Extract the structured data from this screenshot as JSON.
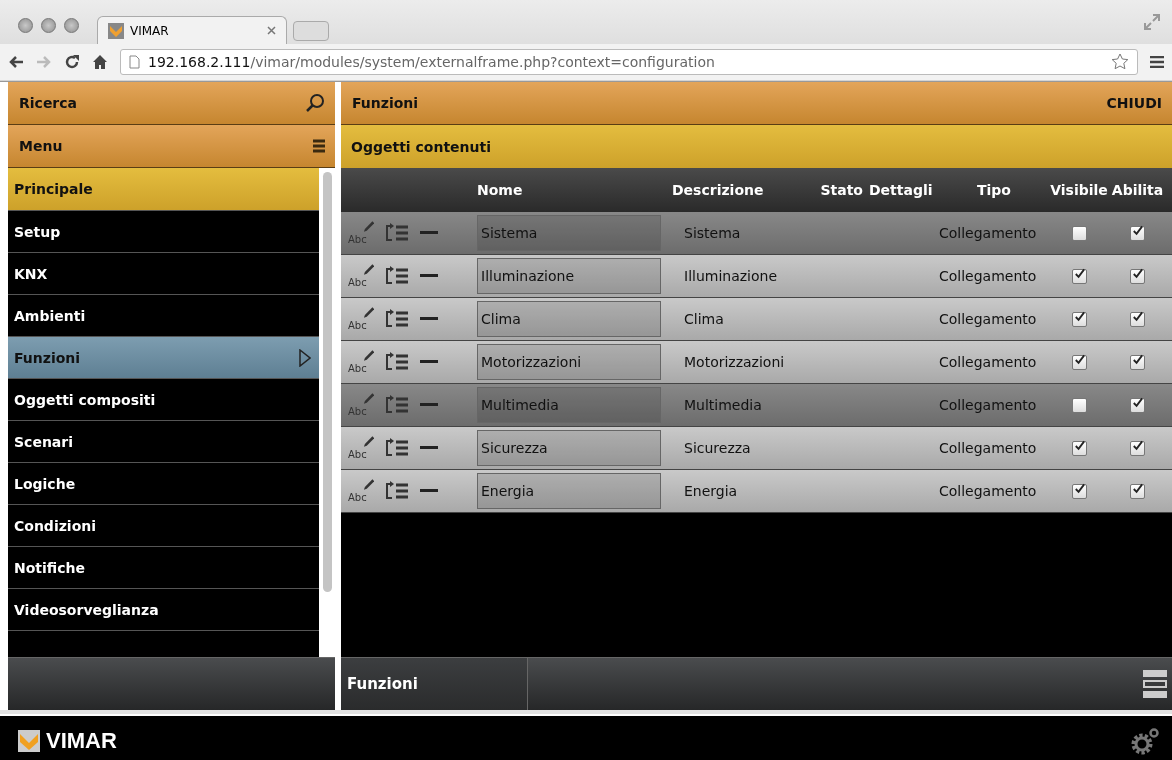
{
  "browser": {
    "tab_title": "VIMAR",
    "url_host": "192.168.2.111",
    "url_path": "/vimar/modules/system/externalframe.php?context=configuration"
  },
  "search_bar": {
    "label": "Ricerca"
  },
  "menu_bar": {
    "label": "Menu"
  },
  "sidebar": {
    "items": [
      {
        "label": "Principale",
        "kind": "header",
        "selected": false
      },
      {
        "label": "Setup",
        "kind": "item",
        "selected": false
      },
      {
        "label": "KNX",
        "kind": "item",
        "selected": false
      },
      {
        "label": "Ambienti",
        "kind": "item",
        "selected": false
      },
      {
        "label": "Funzioni",
        "kind": "item",
        "selected": true
      },
      {
        "label": "Oggetti compositi",
        "kind": "item",
        "selected": false
      },
      {
        "label": "Scenari",
        "kind": "item",
        "selected": false
      },
      {
        "label": "Logiche",
        "kind": "item",
        "selected": false
      },
      {
        "label": "Condizioni",
        "kind": "item",
        "selected": false
      },
      {
        "label": "Notifiche",
        "kind": "item",
        "selected": false
      },
      {
        "label": "Videosorveglianza",
        "kind": "item",
        "selected": false
      }
    ]
  },
  "panel": {
    "title": "Funzioni",
    "close": "CHIUDI",
    "subtitle": "Oggetti contenuti"
  },
  "table": {
    "columns": [
      "Nome",
      "Descrizione",
      "Stato",
      "Dettagli",
      "Tipo",
      "Visibile",
      "Abilita"
    ],
    "rows": [
      {
        "edit_label": "Abc",
        "name": "Sistema",
        "description": "Sistema",
        "type": "Collegamento",
        "visible": false,
        "enabled": true
      },
      {
        "edit_label": "Abc",
        "name": "Illuminazione",
        "description": "Illuminazione",
        "type": "Collegamento",
        "visible": true,
        "enabled": true
      },
      {
        "edit_label": "Abc",
        "name": "Clima",
        "description": "Clima",
        "type": "Collegamento",
        "visible": true,
        "enabled": true
      },
      {
        "edit_label": "Abc",
        "name": "Motorizzazioni",
        "description": "Motorizzazioni",
        "type": "Collegamento",
        "visible": true,
        "enabled": true
      },
      {
        "edit_label": "Abc",
        "name": "Multimedia",
        "description": "Multimedia",
        "type": "Collegamento",
        "visible": false,
        "enabled": true
      },
      {
        "edit_label": "Abc",
        "name": "Sicurezza",
        "description": "Sicurezza",
        "type": "Collegamento",
        "visible": true,
        "enabled": true
      },
      {
        "edit_label": "Abc",
        "name": "Energia",
        "description": "Energia",
        "type": "Collegamento",
        "visible": true,
        "enabled": true
      }
    ]
  },
  "bottom_tab": {
    "label": "Funzioni"
  },
  "footer": {
    "brand": "VIMAR"
  }
}
